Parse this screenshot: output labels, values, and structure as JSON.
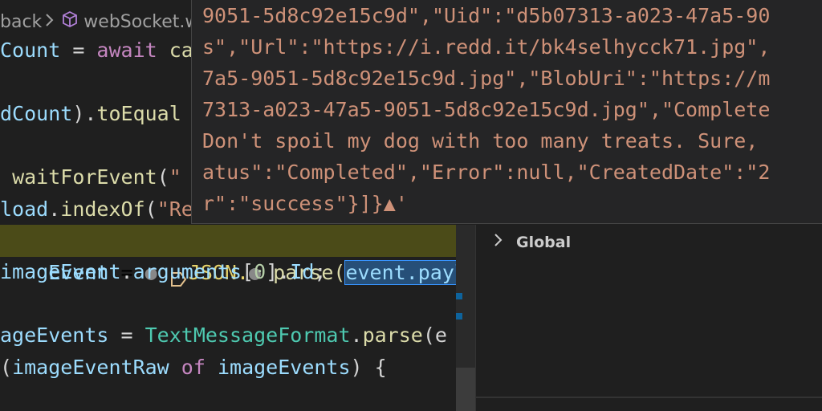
{
  "breadcrumb": {
    "parent": "back",
    "file": "webSocket.wa"
  },
  "code_lines": [
    {
      "segments": [
        {
          "cls": "v",
          "text": "Count"
        },
        {
          "cls": "",
          "text": " = "
        },
        {
          "cls": "k",
          "text": "await"
        },
        {
          "cls": "",
          "text": " "
        },
        {
          "cls": "f",
          "text": "ca"
        }
      ]
    },
    {
      "segments": []
    },
    {
      "segments": [
        {
          "cls": "v",
          "text": "dCount"
        },
        {
          "cls": "",
          "text": ")."
        },
        {
          "cls": "f",
          "text": "toEqual"
        }
      ]
    },
    {
      "segments": []
    },
    {
      "segments": [
        {
          "cls": "",
          "text": " "
        },
        {
          "cls": "f",
          "text": "waitForEvent"
        },
        {
          "cls": "",
          "text": "("
        },
        {
          "cls": "s",
          "text": "\""
        }
      ]
    },
    {
      "segments": [
        {
          "cls": "v",
          "text": "load"
        },
        {
          "cls": "",
          "text": "."
        },
        {
          "cls": "f",
          "text": "indexOf"
        },
        {
          "cls": "",
          "text": "("
        },
        {
          "cls": "s",
          "text": "\"Re"
        }
      ]
    }
  ],
  "highlight_line": {
    "pre": "Event",
    "eq": " = ",
    "json": "JSON.",
    "parse": " parse(",
    "selected": "event.payloa"
  },
  "code_lines_lower": [
    {
      "segments": [
        {
          "cls": "v",
          "text": "imageEvent"
        },
        {
          "cls": "",
          "text": "."
        },
        {
          "cls": "v",
          "text": "arguments"
        },
        {
          "cls": "",
          "text": "["
        },
        {
          "cls": "n",
          "text": "0"
        },
        {
          "cls": "",
          "text": "]."
        },
        {
          "cls": "v",
          "text": "Id"
        },
        {
          "cls": "",
          "text": ";"
        }
      ]
    },
    {
      "segments": []
    },
    {
      "segments": [
        {
          "cls": "v",
          "text": "ageEvents"
        },
        {
          "cls": "",
          "text": " = "
        },
        {
          "cls": "t",
          "text": "TextMessageFormat"
        },
        {
          "cls": "",
          "text": "."
        },
        {
          "cls": "f",
          "text": "parse"
        },
        {
          "cls": "",
          "text": "(e"
        }
      ]
    },
    {
      "segments": [
        {
          "cls": "",
          "text": "("
        },
        {
          "cls": "v",
          "text": "imageEventRaw"
        },
        {
          "cls": "",
          "text": " "
        },
        {
          "cls": "k",
          "text": "of"
        },
        {
          "cls": "",
          "text": " "
        },
        {
          "cls": "v",
          "text": "imageEvents"
        },
        {
          "cls": "",
          "text": ") {"
        }
      ]
    }
  ],
  "hover_lines": [
    "9051-5d8c92e15c9d\",\"Uid\":\"d5b07313-a023-47a5-90",
    "s\",\"Url\":\"https://i.redd.it/bk4selhycck71.jpg\",",
    "7a5-9051-5d8c92e15c9d.jpg\",\"BlobUri\":\"https://m",
    "7313-a023-47a5-9051-5d8c92e15c9d.jpg\",\"Complete",
    "Don't spoil my dog with too many treats. Sure,",
    "atus\":\"Completed\",\"Error\":null,\"CreatedDate\":\"2",
    "r\":\"success\"}]}▲'"
  ],
  "panel": {
    "global_label": "Global"
  },
  "icons": [
    "chevron-right-icon",
    "cube-icon",
    "breakpoint-icon"
  ],
  "colors": {
    "background": "#1f1f1f",
    "hover_bg": "#252526",
    "string": "#ce9178",
    "highlight": "#4b4b18"
  }
}
